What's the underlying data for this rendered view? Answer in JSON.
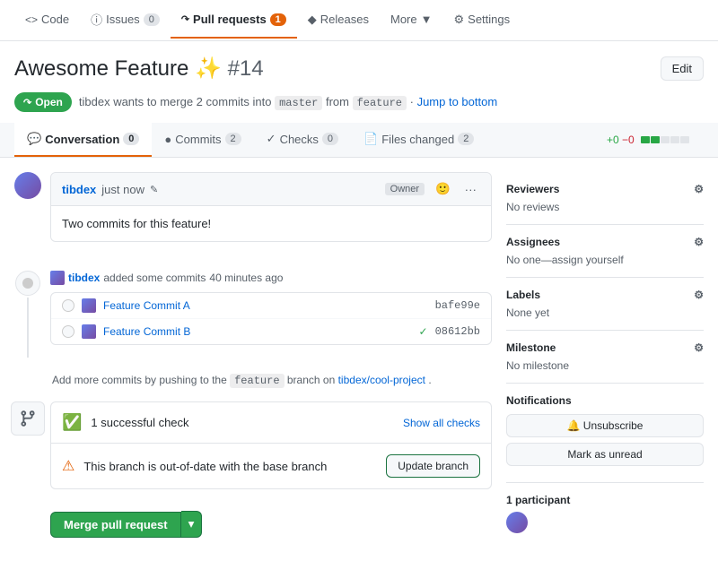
{
  "nav": {
    "items": [
      {
        "id": "code",
        "label": "Code",
        "icon": "<>",
        "count": null,
        "active": false
      },
      {
        "id": "issues",
        "label": "Issues",
        "icon": "!",
        "count": "0",
        "active": false
      },
      {
        "id": "pull-requests",
        "label": "Pull requests",
        "icon": "PR",
        "count": "1",
        "active": true
      },
      {
        "id": "releases",
        "label": "Releases",
        "icon": "◇",
        "count": null,
        "active": false
      },
      {
        "id": "more",
        "label": "More",
        "icon": "",
        "count": null,
        "active": false
      },
      {
        "id": "settings",
        "label": "Settings",
        "icon": "⚙",
        "count": null,
        "active": false
      }
    ]
  },
  "header": {
    "title": "Awesome Feature",
    "sparkle": "✨",
    "pr_number": "#14",
    "edit_label": "Edit"
  },
  "status": {
    "badge": "Open",
    "description": "tibdex wants to merge 2 commits into",
    "base_branch": "master",
    "from_label": "from",
    "head_branch": "feature",
    "jump_label": "Jump to bottom"
  },
  "tabs": {
    "items": [
      {
        "id": "conversation",
        "label": "Conversation",
        "count": "0",
        "active": true
      },
      {
        "id": "commits",
        "label": "Commits",
        "count": "2",
        "active": false
      },
      {
        "id": "checks",
        "label": "Checks",
        "count": "0",
        "active": false
      },
      {
        "id": "files-changed",
        "label": "Files changed",
        "count": "2",
        "active": false
      }
    ],
    "diff_stats": "+0 −0"
  },
  "comment": {
    "author": "tibdex",
    "time": "just now",
    "owner_badge": "Owner",
    "body": "Two commits for this feature!"
  },
  "commit_section": {
    "header_author": "tibdex",
    "header_action": "added some commits",
    "header_time": "40 minutes ago",
    "commits": [
      {
        "message": "Feature Commit A",
        "sha": "bafe99e",
        "has_check": false
      },
      {
        "message": "Feature Commit B",
        "sha": "08612bb",
        "has_check": true
      }
    ]
  },
  "add_commits_info": {
    "text_before": "Add more commits by pushing to the",
    "branch": "feature",
    "text_mid": "branch on",
    "repo": "tibdex/cool-project",
    "text_after": "."
  },
  "checks": {
    "success": {
      "text": "1 successful check",
      "show_all": "Show all checks"
    },
    "warning": {
      "text": "This branch is out-of-date with the base branch",
      "update_btn": "Update branch"
    }
  },
  "merge": {
    "btn_label": "Merge pull request",
    "dropdown_icon": "▾"
  },
  "sidebar": {
    "reviewers": {
      "title": "Reviewers",
      "value": "No reviews",
      "gear": "⚙"
    },
    "assignees": {
      "title": "Assignees",
      "value": "No one—assign yourself",
      "gear": "⚙"
    },
    "labels": {
      "title": "Labels",
      "value": "None yet",
      "gear": "⚙"
    },
    "milestone": {
      "title": "Milestone",
      "value": "No milestone",
      "gear": "⚙"
    },
    "notifications": {
      "title": "Notifications",
      "unsubscribe_label": "🔔 Unsubscribe",
      "mark_unread_label": "Mark as unread"
    },
    "participants": {
      "title": "1 participant"
    }
  }
}
